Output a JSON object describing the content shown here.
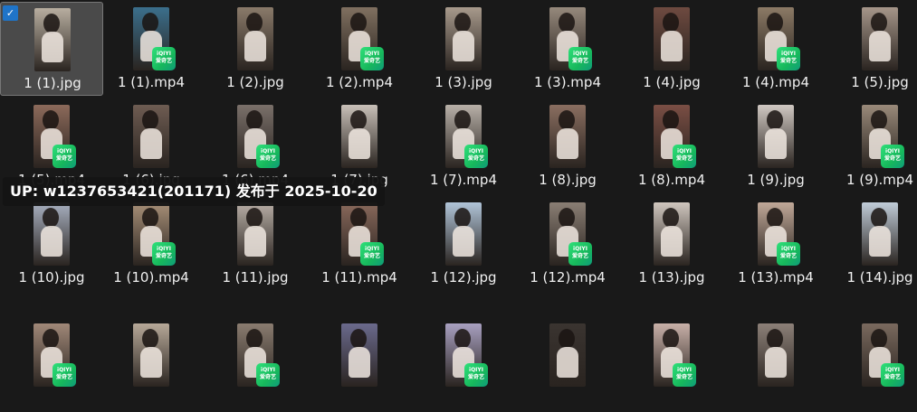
{
  "files": [
    {
      "label": "1 (1).jpg",
      "type": "image",
      "selected": true,
      "color": "#b8aea0"
    },
    {
      "label": "1 (1).mp4",
      "type": "video",
      "color": "#3b6f8c"
    },
    {
      "label": "1 (2).jpg",
      "type": "image",
      "color": "#8a7a6a"
    },
    {
      "label": "1 (2).mp4",
      "type": "video",
      "color": "#807060"
    },
    {
      "label": "1 (3).jpg",
      "type": "image",
      "color": "#a89a8c"
    },
    {
      "label": "1 (3).mp4",
      "type": "video",
      "color": "#96897c"
    },
    {
      "label": "1 (4).jpg",
      "type": "image",
      "color": "#6e4a40"
    },
    {
      "label": "1 (4).mp4",
      "type": "video",
      "color": "#8c7a66"
    },
    {
      "label": "1 (5).jpg",
      "type": "image",
      "color": "#a6968a"
    },
    {
      "label": "1 (5).mp4",
      "type": "video",
      "color": "#8c6a5a"
    },
    {
      "label": "1 (6).jpg",
      "type": "image",
      "color": "#6e5c52"
    },
    {
      "label": "1 (6).mp4",
      "type": "video",
      "color": "#7a706a"
    },
    {
      "label": "1 (7).jpg",
      "type": "image",
      "color": "#c8c0b8"
    },
    {
      "label": "1 (7).mp4",
      "type": "video",
      "color": "#b8b0a8"
    },
    {
      "label": "1 (8).jpg",
      "type": "image",
      "color": "#8a6e60"
    },
    {
      "label": "1 (8).mp4",
      "type": "video",
      "color": "#7a4e44"
    },
    {
      "label": "1 (9).jpg",
      "type": "image",
      "color": "#d0c8c2"
    },
    {
      "label": "1 (9).mp4",
      "type": "video",
      "color": "#9a8a7a"
    },
    {
      "label": "1 (10).jpg",
      "type": "image",
      "color": "#a8b0c0"
    },
    {
      "label": "1 (10).mp4",
      "type": "video",
      "color": "#a89078"
    },
    {
      "label": "1 (11).jpg",
      "type": "image",
      "color": "#b8aea6"
    },
    {
      "label": "1 (11).mp4",
      "type": "video",
      "color": "#8a6a5c"
    },
    {
      "label": "1 (12).jpg",
      "type": "image",
      "color": "#b0c4d8"
    },
    {
      "label": "1 (12).mp4",
      "type": "video",
      "color": "#8a7e74"
    },
    {
      "label": "1 (13).jpg",
      "type": "image",
      "color": "#cfc6be"
    },
    {
      "label": "1 (13).mp4",
      "type": "video",
      "color": "#c0a898"
    },
    {
      "label": "1 (14).jpg",
      "type": "image",
      "color": "#c0ccd8"
    },
    {
      "label": "",
      "type": "video",
      "color": "#a08878"
    },
    {
      "label": "",
      "type": "image",
      "color": "#b6a898"
    },
    {
      "label": "",
      "type": "video",
      "color": "#8a7c70"
    },
    {
      "label": "",
      "type": "image",
      "color": "#6a6a8c"
    },
    {
      "label": "",
      "type": "video",
      "color": "#a8a0c0"
    },
    {
      "label": "",
      "type": "image",
      "color": "#3a3430"
    },
    {
      "label": "",
      "type": "video",
      "color": "#c8b0a8"
    },
    {
      "label": "",
      "type": "image",
      "color": "#8c8078"
    },
    {
      "label": "",
      "type": "video",
      "color": "#7a6a5e"
    }
  ],
  "badge": {
    "line1": "iQIYI",
    "line2": "爱奇艺"
  },
  "overlay_text": "UP: w1237653421(201171) 发布于 2025-10-20",
  "check_glyph": "✓"
}
